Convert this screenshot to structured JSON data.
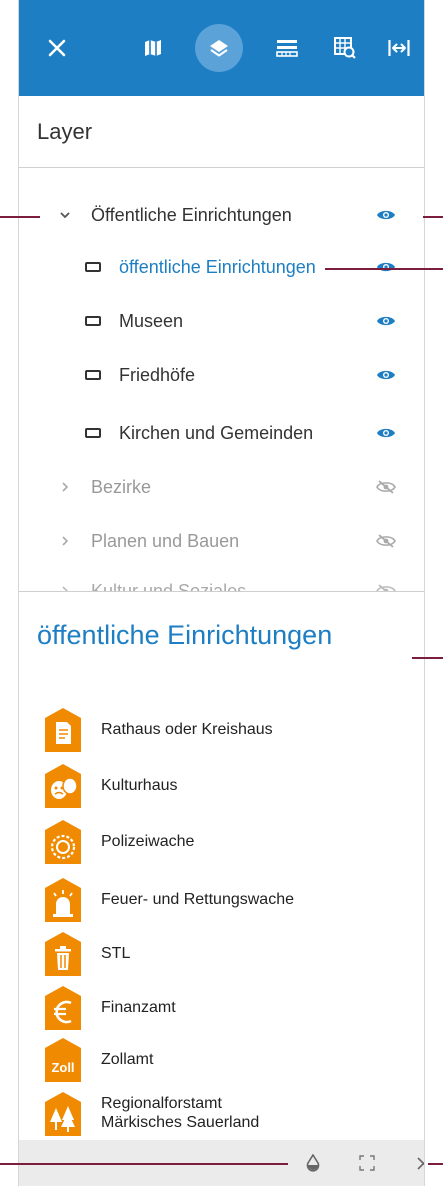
{
  "colors": {
    "accent": "#1d7ec4",
    "toolbar_active": "#5ba2d8",
    "legend_orange": "#f08a00",
    "callout": "#7c1d3b"
  },
  "toolbar": {
    "close_icon": "close-icon",
    "buttons": [
      "map-icon",
      "layers-icon",
      "legend-icon",
      "search-map-icon",
      "expand-width-icon"
    ],
    "active": "layers-icon"
  },
  "layer_panel": {
    "title": "Layer",
    "rows": [
      {
        "label": "Öffentliche Einrichtungen",
        "expanded": true,
        "visible": true
      },
      {
        "label": "öffentliche Einrichtungen",
        "selected": true,
        "visible": true
      },
      {
        "label": "Museen",
        "visible": true
      },
      {
        "label": "Friedhöfe",
        "visible": true
      },
      {
        "label": "Kirchen und Gemeinden",
        "visible": true
      },
      {
        "label": "Bezirke",
        "expanded": false,
        "visible": false
      },
      {
        "label": "Planen und Bauen",
        "expanded": false,
        "visible": false
      },
      {
        "label": "Kultur und Soziales",
        "expanded": false,
        "visible": false
      }
    ]
  },
  "legend": {
    "title": "öffentliche Einrichtungen",
    "items": [
      {
        "label": "Rathaus oder Kreishaus",
        "icon": "document-icon"
      },
      {
        "label": "Kulturhaus",
        "icon": "theater-masks-icon"
      },
      {
        "label": "Polizeiwache",
        "icon": "police-star-icon"
      },
      {
        "label": "Feuer- und Rettungswache",
        "icon": "siren-icon"
      },
      {
        "label": "STL",
        "icon": "trash-bin-icon"
      },
      {
        "label": "Finanzamt",
        "icon": "euro-icon"
      },
      {
        "label": "Zollamt",
        "icon": "customs-icon",
        "icon_text": "Zoll"
      },
      {
        "label_line1": "Regionalforstamt",
        "label_line2": "Märkisches Sauerland",
        "icon": "forest-icon"
      }
    ]
  },
  "bottom_bar": {
    "buttons": [
      "opacity-icon",
      "zoom-to-extent-icon",
      "remove-icon"
    ]
  }
}
